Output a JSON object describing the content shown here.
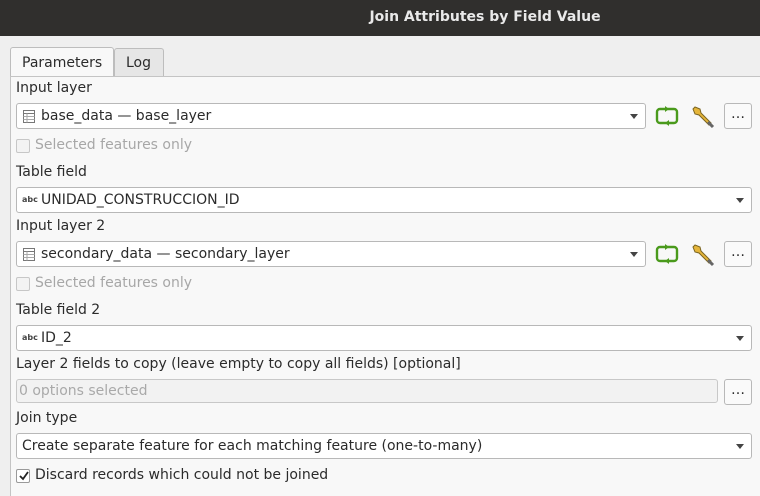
{
  "window": {
    "title": "Join Attributes by Field Value"
  },
  "tabs": [
    {
      "label": "Parameters",
      "active": true
    },
    {
      "label": "Log",
      "active": false
    }
  ],
  "params": {
    "input_layer": {
      "label": "Input layer",
      "value": "base_data — base_layer",
      "selected_only": "Selected features only"
    },
    "table_field": {
      "label": "Table field",
      "type_icon": "abc",
      "value": "UNIDAD_CONSTRUCCION_ID"
    },
    "input_layer_2": {
      "label": "Input layer 2",
      "value": "secondary_data — secondary_layer",
      "selected_only": "Selected features only"
    },
    "table_field_2": {
      "label": "Table field 2",
      "type_icon": "abc",
      "value": "ID_2"
    },
    "layer2_fields": {
      "label": "Layer 2 fields to copy (leave empty to copy all fields) [optional]",
      "placeholder": "0 options selected"
    },
    "join_type": {
      "label": "Join type",
      "value": "Create separate feature for each matching feature (one-to-many)"
    },
    "discard": {
      "label": "Discard records which could not be joined",
      "checked": true
    }
  },
  "buttons": {
    "more": "…"
  },
  "colors": {
    "titlebar": "#302f2d",
    "iterate_icon": "#4a9a1c"
  }
}
